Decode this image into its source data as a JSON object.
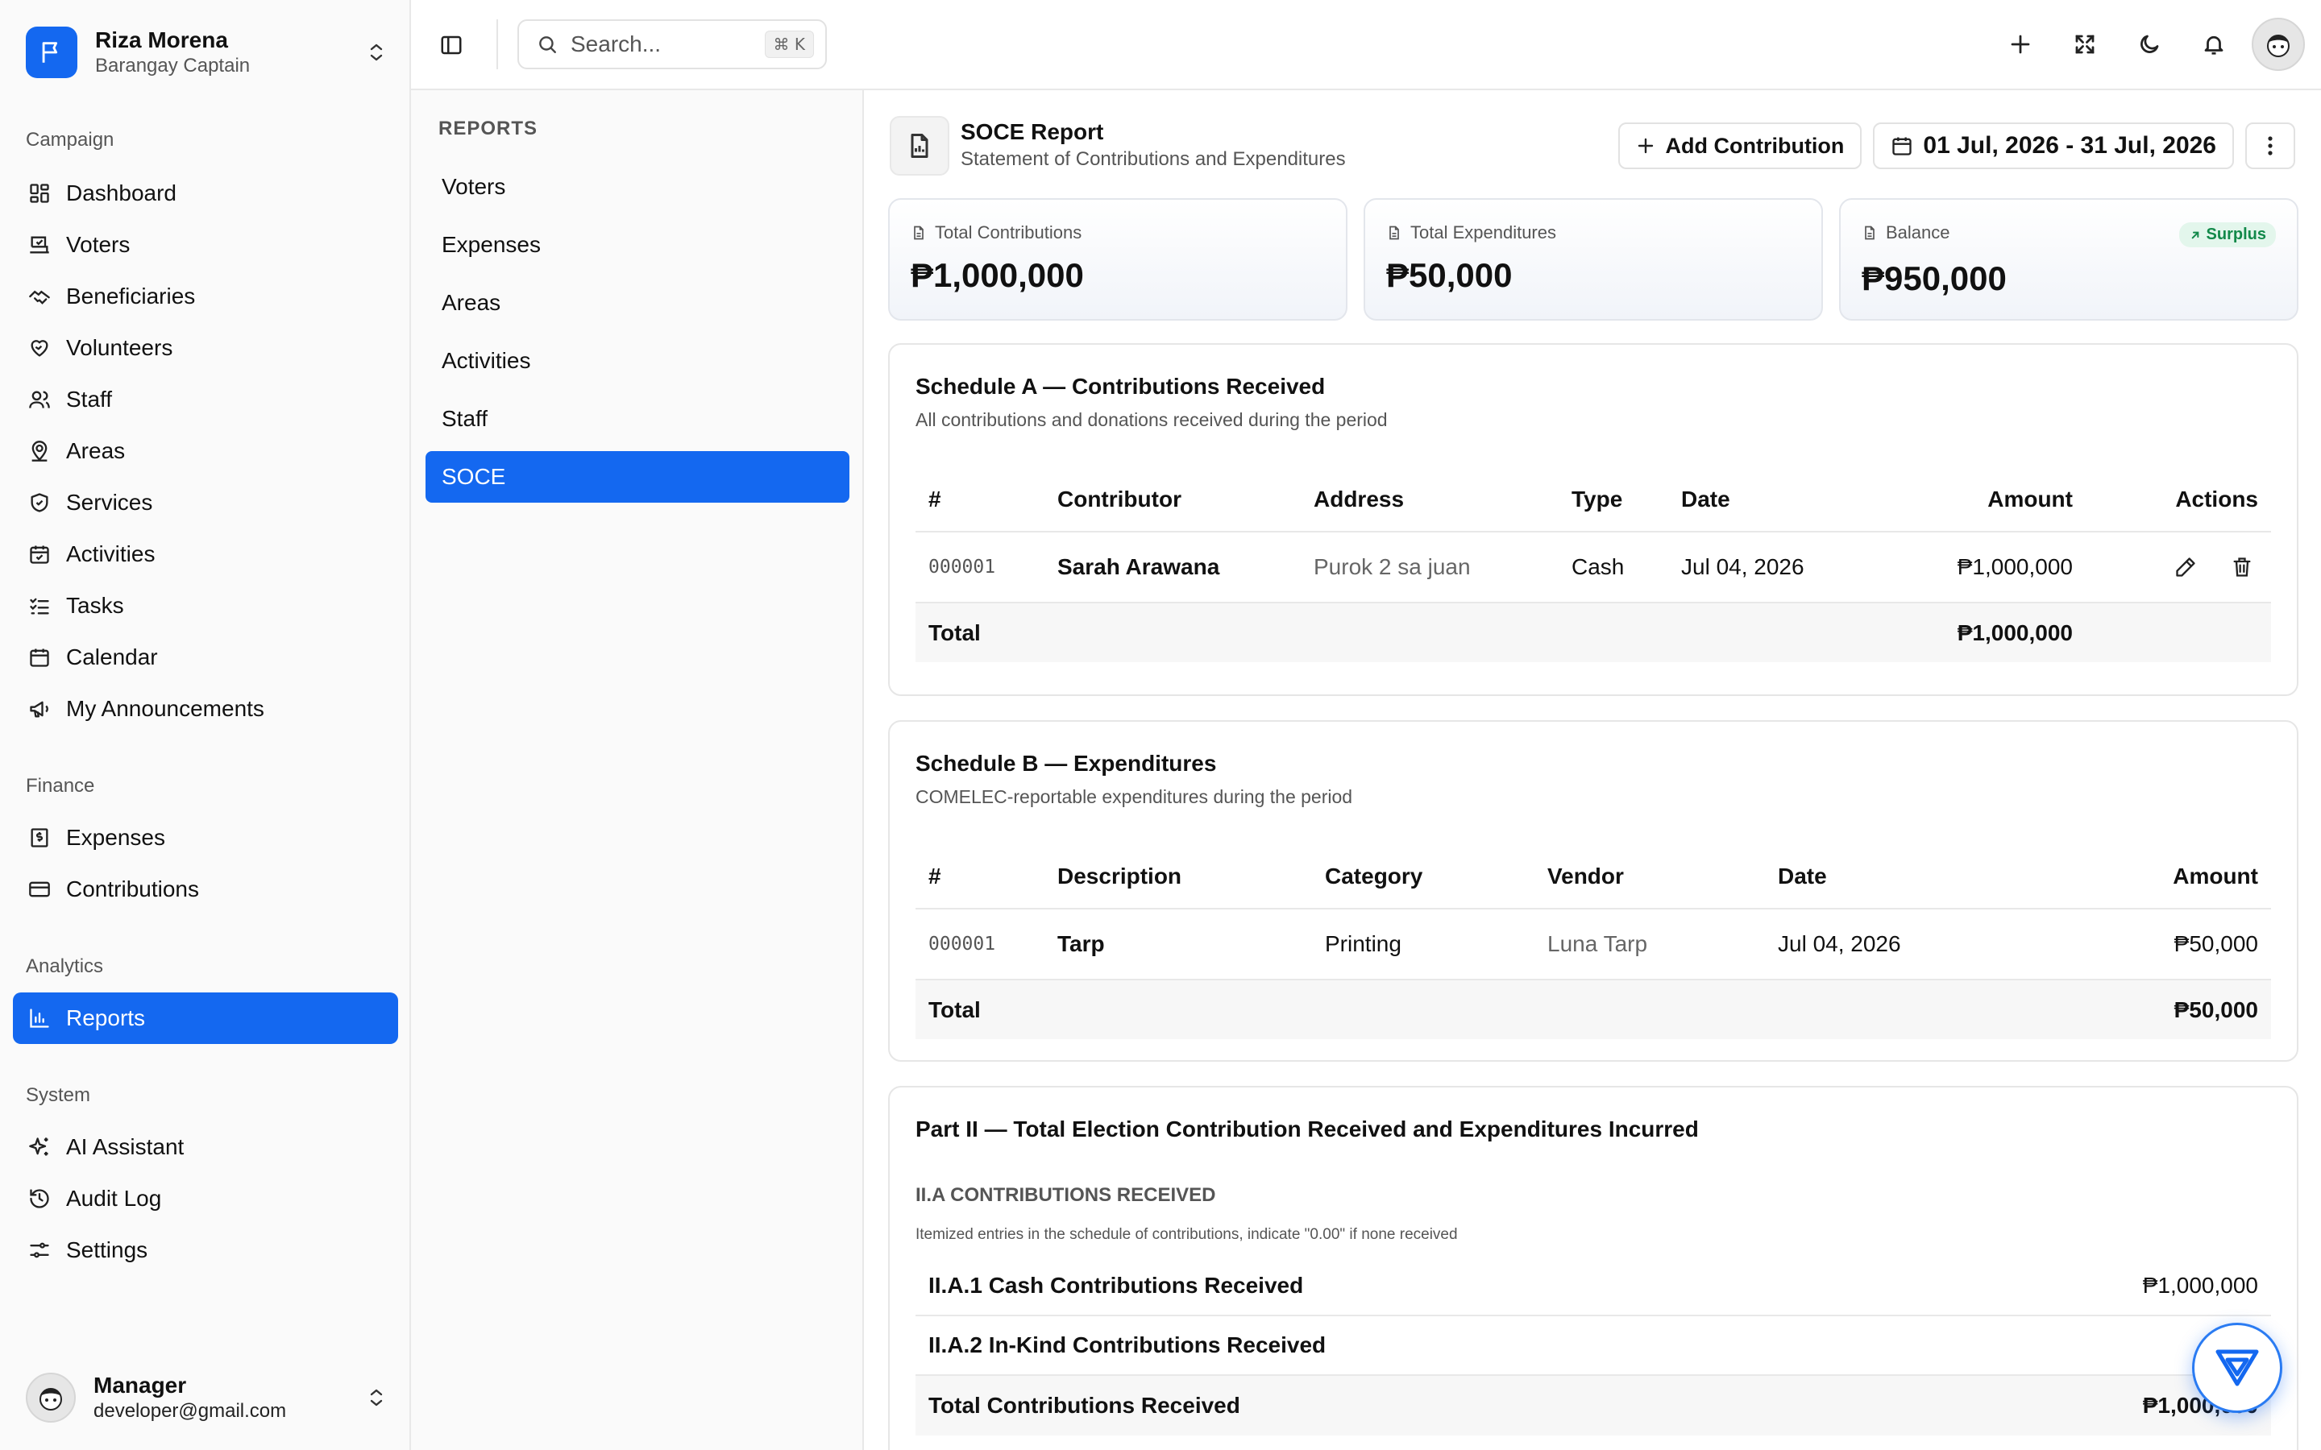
{
  "user": {
    "name": "Riza Morena",
    "role": "Barangay Captain"
  },
  "sidebar": {
    "groups": [
      {
        "title": "Campaign",
        "items": [
          {
            "label": "Dashboard",
            "icon": "dashboard-icon"
          },
          {
            "label": "Voters",
            "icon": "ballot-icon"
          },
          {
            "label": "Beneficiaries",
            "icon": "handshake-icon"
          },
          {
            "label": "Volunteers",
            "icon": "heart-handshake-icon"
          },
          {
            "label": "Staff",
            "icon": "users-icon"
          },
          {
            "label": "Areas",
            "icon": "map-pin-icon"
          },
          {
            "label": "Services",
            "icon": "shield-check-icon"
          },
          {
            "label": "Activities",
            "icon": "calendar-check-icon"
          },
          {
            "label": "Tasks",
            "icon": "list-checks-icon"
          },
          {
            "label": "Calendar",
            "icon": "calendar-icon"
          },
          {
            "label": "My Announcements",
            "icon": "megaphone-icon"
          }
        ]
      },
      {
        "title": "Finance",
        "items": [
          {
            "label": "Expenses",
            "icon": "receipt-icon"
          },
          {
            "label": "Contributions",
            "icon": "wallet-icon"
          }
        ]
      },
      {
        "title": "Analytics",
        "items": [
          {
            "label": "Reports",
            "icon": "bar-chart-icon",
            "active": true
          }
        ]
      },
      {
        "title": "System",
        "items": [
          {
            "label": "AI Assistant",
            "icon": "sparkles-icon"
          },
          {
            "label": "Audit Log",
            "icon": "history-icon"
          },
          {
            "label": "Settings",
            "icon": "settings-sliders-icon"
          }
        ]
      }
    ]
  },
  "account": {
    "name": "Manager",
    "email": "developer@gmail.com"
  },
  "header": {
    "search_placeholder": "Search...",
    "shortcut": "⌘ K"
  },
  "reports_panel": {
    "title": "REPORTS",
    "items": [
      "Voters",
      "Expenses",
      "Areas",
      "Activities",
      "Staff",
      "SOCE"
    ],
    "active": "SOCE"
  },
  "page": {
    "title": "SOCE Report",
    "subtitle": "Statement of Contributions and Expenditures",
    "add_button": "Add Contribution",
    "date_range": "01 Jul, 2026 - 31 Jul, 2026"
  },
  "stats": [
    {
      "label": "Total Contributions",
      "value": "₱1,000,000"
    },
    {
      "label": "Total Expenditures",
      "value": "₱50,000"
    },
    {
      "label": "Balance",
      "value": "₱950,000",
      "badge": "Surplus"
    }
  ],
  "schedule_a": {
    "title": "Schedule A — Contributions Received",
    "subtitle": "All contributions and donations received during the period",
    "columns": [
      "#",
      "Contributor",
      "Address",
      "Type",
      "Date",
      "Amount",
      "Actions"
    ],
    "rows": [
      {
        "id": "000001",
        "contributor": "Sarah Arawana",
        "address": "Purok 2 sa juan",
        "type": "Cash",
        "date": "Jul 04, 2026",
        "amount": "₱1,000,000"
      }
    ],
    "total_label": "Total",
    "total": "₱1,000,000"
  },
  "schedule_b": {
    "title": "Schedule B — Expenditures",
    "subtitle": "COMELEC-reportable expenditures during the period",
    "columns": [
      "#",
      "Description",
      "Category",
      "Vendor",
      "Date",
      "Amount"
    ],
    "rows": [
      {
        "id": "000001",
        "description": "Tarp",
        "category": "Printing",
        "vendor": "Luna Tarp",
        "date": "Jul 04, 2026",
        "amount": "₱50,000"
      }
    ],
    "total_label": "Total",
    "total": "₱50,000"
  },
  "part_ii": {
    "title": "Part II — Total Election Contribution Received and Expenditures Incurred",
    "section": "II.A CONTRIBUTIONS RECEIVED",
    "note": "Itemized entries in the schedule of contributions, indicate \"0.00\" if none received",
    "rows": [
      {
        "label": "II.A.1 Cash Contributions Received",
        "value": "₱1,000,000"
      },
      {
        "label": "II.A.2 In-Kind Contributions Received",
        "value": ""
      },
      {
        "label": "Total Contributions Received",
        "value": "₱1,000,000"
      }
    ]
  },
  "colors": {
    "accent": "#1468f0",
    "surplus_bg": "#e3f6ec",
    "surplus_text": "#12894a"
  }
}
